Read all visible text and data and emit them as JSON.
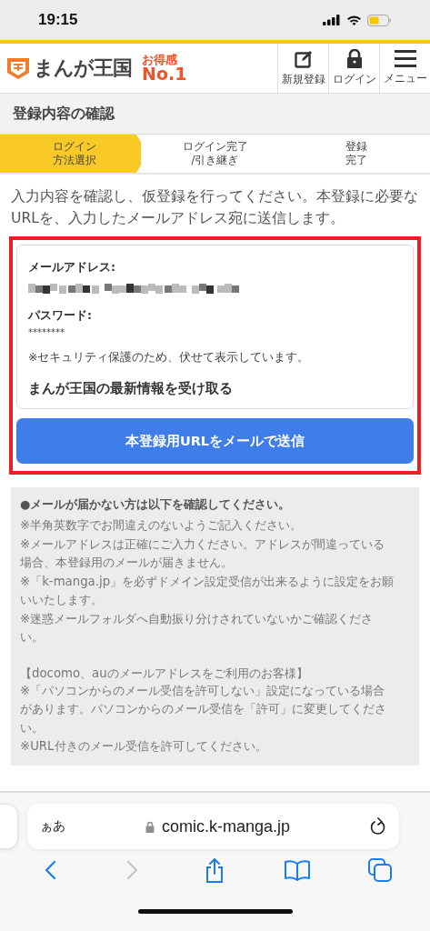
{
  "status_bar": {
    "time": "19:15"
  },
  "header": {
    "logo_text": "まんが王国",
    "badge_top": "お得感",
    "badge_bottom": "No.1",
    "nav": [
      {
        "kind": "edit",
        "label": "新規登録"
      },
      {
        "kind": "lock",
        "label": "ログイン"
      },
      {
        "kind": "menu",
        "label": "メニュー"
      }
    ]
  },
  "page_title": "登録内容の確認",
  "steps": [
    {
      "lines": [
        "ログイン",
        "方法選択"
      ],
      "selected": true
    },
    {
      "lines": [
        "ログイン完了",
        "/引き継ぎ"
      ],
      "selected": false
    },
    {
      "lines": [
        "登録",
        "完了"
      ],
      "selected": false
    }
  ],
  "intro": "入力内容を確認し、仮登録を行ってください。本登録に必要なURLを、入力したメールアドレス宛に送信します。",
  "confirm": {
    "email_label": "メールアドレス:",
    "password_label": "パスワード:",
    "password_value": "********",
    "security_note": "※セキュリティ保護のため、伏せて表示しています。",
    "newsletter": "まんが王国の最新情報を受け取る"
  },
  "submit_button": "本登録用URLをメールで送信",
  "notes": {
    "heading": "●メールが届かない方は以下を確認してください。",
    "items": [
      "※半角英数字でお間違えのないようご記入ください。",
      "※メールアドレスは正確にご入力ください。アドレスが間違っている場合、本登録用のメールが届きません。",
      "※「k-manga.jp」を必ずドメイン設定受信が出来るように設定をお願いいたします。",
      "※迷惑メールフォルダへ自動振り分けされていないかご確認ください。"
    ],
    "subheading": "【docomo、auのメールアドレスをご利用のお客様】",
    "sub_items": [
      "※「パソコンからのメール受信を許可しない」設定になっている場合があります。パソコンからのメール受信を「許可」に変更してください。",
      "※URL付きのメール受信を許可してください。"
    ]
  },
  "browser": {
    "text_size": "ぁあ",
    "url": "comic.k-manga.jp",
    "toolbar": [
      {
        "kind": "back",
        "disabled": false
      },
      {
        "kind": "forward",
        "disabled": true
      },
      {
        "kind": "share",
        "disabled": false
      },
      {
        "kind": "bookmarks",
        "disabled": false
      },
      {
        "kind": "tabs",
        "disabled": false
      }
    ]
  }
}
